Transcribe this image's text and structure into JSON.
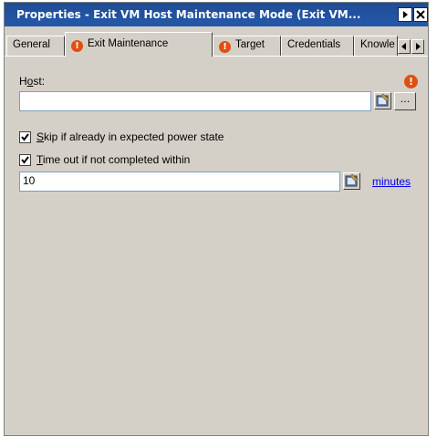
{
  "window": {
    "title": "Properties - Exit VM Host Maintenance Mode (Exit VM..."
  },
  "tabs": [
    {
      "label": "General",
      "warning": false,
      "active": false
    },
    {
      "label": "Exit Maintenance",
      "warning": true,
      "active": true
    },
    {
      "label": "Target",
      "warning": true,
      "active": false
    },
    {
      "label": "Credentials",
      "warning": false,
      "active": false
    },
    {
      "label": "Knowle",
      "warning": false,
      "active": false
    }
  ],
  "form": {
    "host_label_prefix": "H",
    "host_label_underlined": "o",
    "host_label_suffix": "st:",
    "host_value": "",
    "browse_label": "...",
    "skip_checked": true,
    "skip_label_underlined": "S",
    "skip_label_rest": "kip if already in expected power state",
    "timeout_checked": true,
    "timeout_label_underlined": "T",
    "timeout_label_rest": "ime out if not completed within",
    "timeout_value": "10",
    "units_link": "minutes"
  },
  "icons": {
    "warning": "!",
    "warning_color": "#e05010",
    "titlebar_bg": "#1f4b96"
  }
}
